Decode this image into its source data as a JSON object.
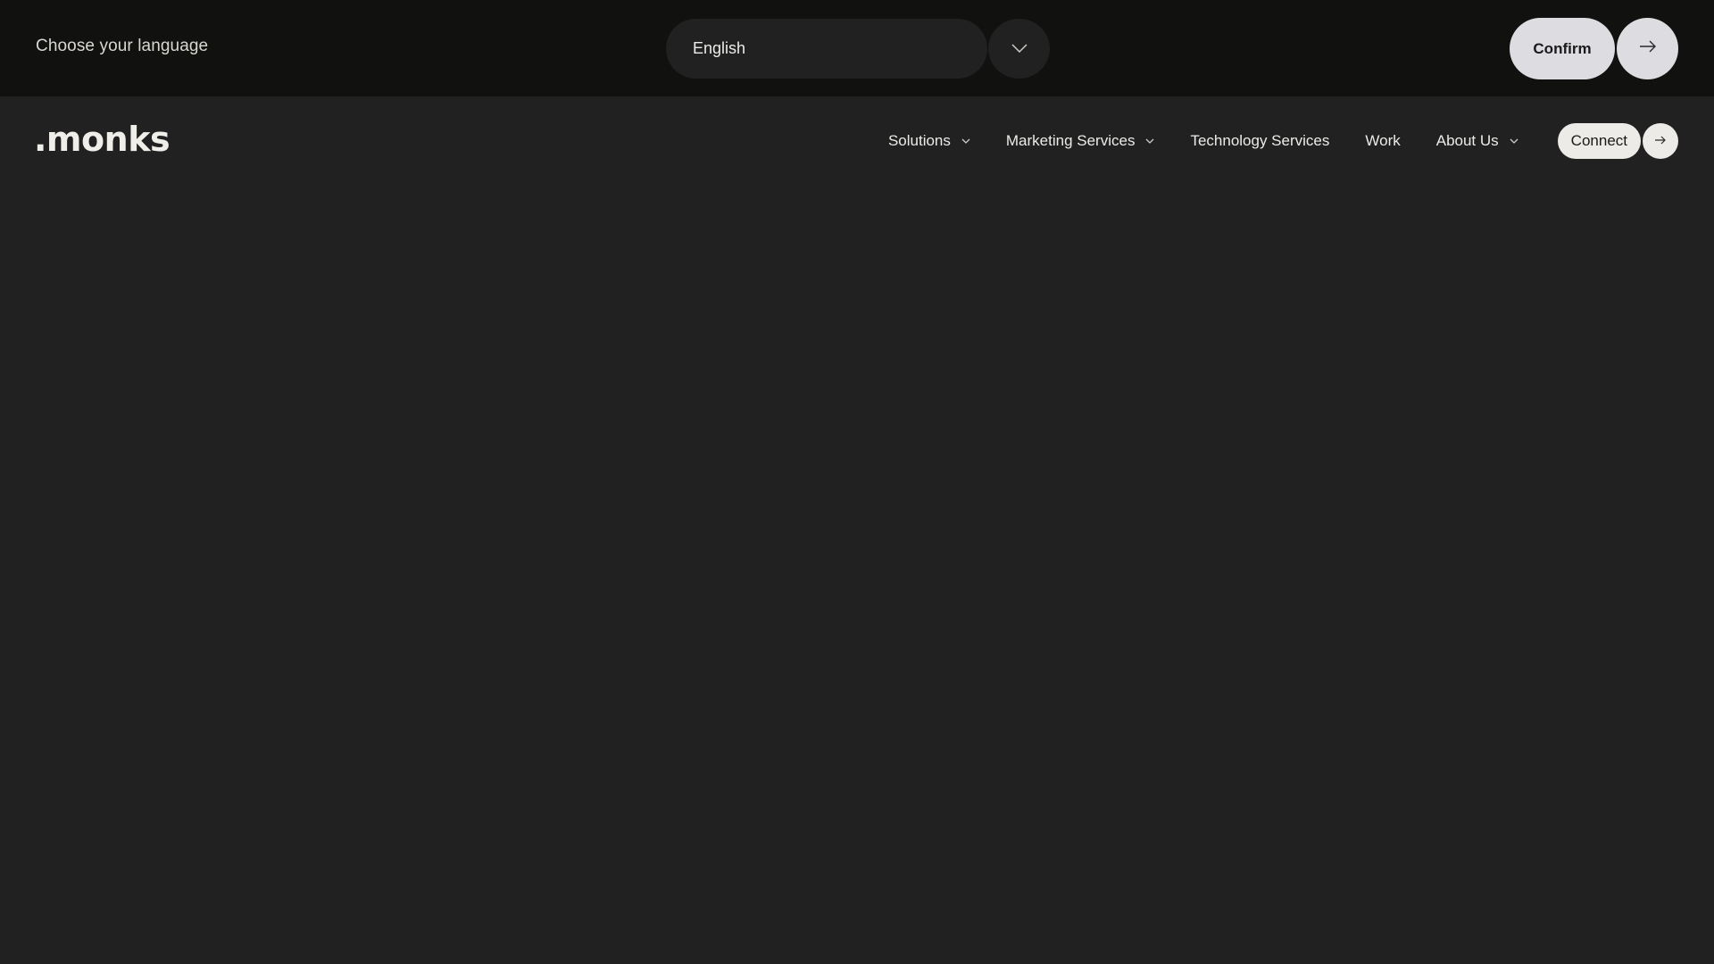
{
  "language_bar": {
    "prompt": "Choose your language",
    "selected_language": "English",
    "toggle_icon": "chevron-down-icon",
    "confirm_label": "Confirm",
    "confirm_icon": "arrow-right-icon"
  },
  "navbar": {
    "logo": ".monks",
    "items": [
      {
        "label": "Solutions",
        "has_dropdown": true
      },
      {
        "label": "Marketing Services",
        "has_dropdown": true
      },
      {
        "label": "Technology Services",
        "has_dropdown": false
      },
      {
        "label": "Work",
        "has_dropdown": false
      },
      {
        "label": "About Us",
        "has_dropdown": true
      }
    ],
    "connect_label": "Connect",
    "connect_icon": "arrow-right-icon"
  },
  "colors": {
    "language_bar_bg": "#111110",
    "page_bg": "#212121",
    "confirm_bg": "#dcdce1",
    "connect_bg": "#ecebe7",
    "text": "#ecebe7"
  }
}
